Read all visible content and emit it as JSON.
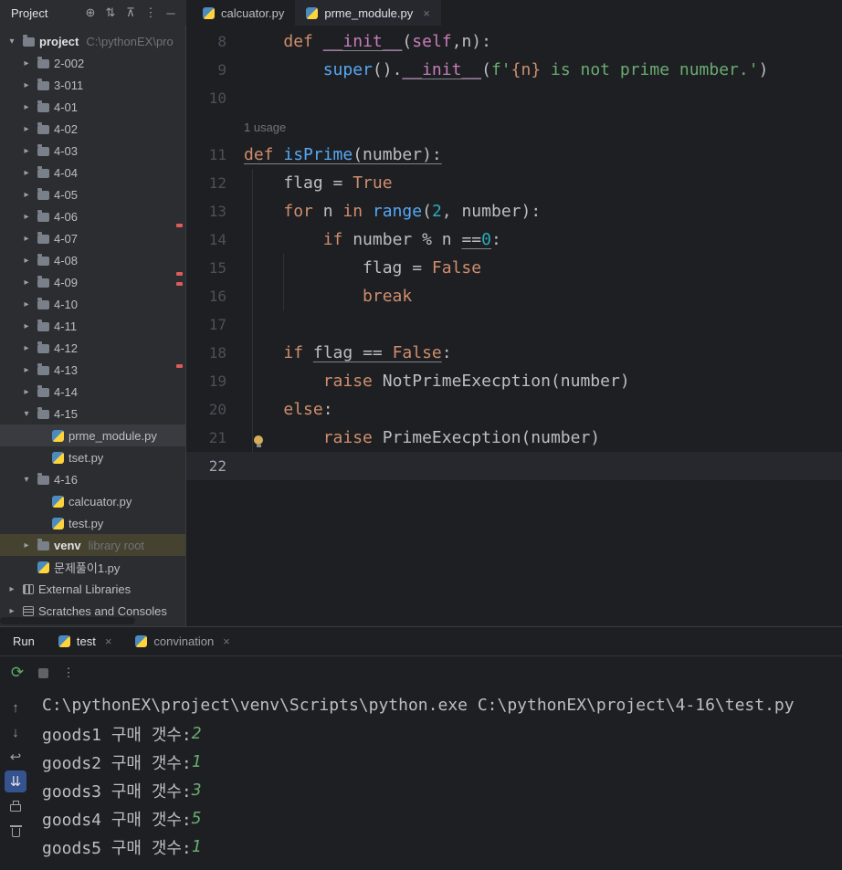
{
  "colors": {
    "bg-editor": "#1e1f22",
    "bg-panel": "#2b2d30",
    "text": "#bcbec4",
    "kw": "#cf8e6d",
    "fn": "#56a8f5",
    "magic": "#c77dbb",
    "str": "#6aab73",
    "num": "#2aacb8",
    "brace": "#cf8e6d",
    "accent": "#3574f0",
    "error": "#db5c5c",
    "console-green": "#6aab73"
  },
  "project_panel": {
    "title": "Project",
    "header_icons": [
      "select-opened-file",
      "sort",
      "collapse-all",
      "more-options",
      "hide-panel"
    ],
    "tree": [
      {
        "label": "project",
        "path_suffix": "C:\\pythonEX\\pro",
        "level": 0,
        "type": "root",
        "state": "expanded"
      },
      {
        "label": "2-002",
        "level": 1,
        "type": "folder",
        "state": "collapsed"
      },
      {
        "label": "3-011",
        "level": 1,
        "type": "folder",
        "state": "collapsed"
      },
      {
        "label": "4-01",
        "level": 1,
        "type": "folder",
        "state": "collapsed"
      },
      {
        "label": "4-02",
        "level": 1,
        "type": "folder",
        "state": "collapsed"
      },
      {
        "label": "4-03",
        "level": 1,
        "type": "folder",
        "state": "collapsed"
      },
      {
        "label": "4-04",
        "level": 1,
        "type": "folder",
        "state": "collapsed"
      },
      {
        "label": "4-05",
        "level": 1,
        "type": "folder",
        "state": "collapsed"
      },
      {
        "label": "4-06",
        "level": 1,
        "type": "folder",
        "state": "collapsed"
      },
      {
        "label": "4-07",
        "level": 1,
        "type": "folder",
        "state": "collapsed"
      },
      {
        "label": "4-08",
        "level": 1,
        "type": "folder",
        "state": "collapsed"
      },
      {
        "label": "4-09",
        "level": 1,
        "type": "folder",
        "state": "collapsed"
      },
      {
        "label": "4-10",
        "level": 1,
        "type": "folder",
        "state": "collapsed"
      },
      {
        "label": "4-11",
        "level": 1,
        "type": "folder",
        "state": "collapsed"
      },
      {
        "label": "4-12",
        "level": 1,
        "type": "folder",
        "state": "collapsed"
      },
      {
        "label": "4-13",
        "level": 1,
        "type": "folder",
        "state": "collapsed"
      },
      {
        "label": "4-14",
        "level": 1,
        "type": "folder",
        "state": "collapsed"
      },
      {
        "label": "4-15",
        "level": 1,
        "type": "folder",
        "state": "expanded"
      },
      {
        "label": "prme_module.py",
        "level": 2,
        "type": "python-file",
        "selected": true
      },
      {
        "label": "tset.py",
        "level": 2,
        "type": "python-file"
      },
      {
        "label": "4-16",
        "level": 1,
        "type": "folder",
        "state": "expanded"
      },
      {
        "label": "calcuator.py",
        "level": 2,
        "type": "python-file"
      },
      {
        "label": "test.py",
        "level": 2,
        "type": "python-file"
      },
      {
        "label": "venv",
        "suffix": "library root",
        "level": 1,
        "type": "folder",
        "state": "collapsed",
        "highlighted": true,
        "bold": true
      },
      {
        "label": "문제풀이1.py",
        "level": 1,
        "type": "python-file"
      },
      {
        "label": "External Libraries",
        "level": 0,
        "type": "libraries",
        "state": "collapsed"
      },
      {
        "label": "Scratches and Consoles",
        "level": 0,
        "type": "scratches",
        "state": "collapsed"
      }
    ]
  },
  "editor_tabs": [
    {
      "label": "calcuator.py",
      "active": false,
      "closable": false
    },
    {
      "label": "prme_module.py",
      "active": true,
      "closable": true
    }
  ],
  "editor": {
    "usage_hint": "1 usage",
    "rows": [
      {
        "num": "8",
        "segs": [
          {
            "t": "    "
          },
          {
            "t": "def ",
            "c": "kw"
          },
          {
            "t": "__init__",
            "c": "magic",
            "u": true
          },
          {
            "t": "("
          },
          {
            "t": "self",
            "c": "magic"
          },
          {
            "t": ",n):"
          }
        ]
      },
      {
        "num": "9",
        "segs": [
          {
            "t": "        "
          },
          {
            "t": "super",
            "c": "fn"
          },
          {
            "t": "()."
          },
          {
            "t": "__init__",
            "c": "magic",
            "u": true
          },
          {
            "t": "("
          },
          {
            "t": "f'",
            "c": "str"
          },
          {
            "t": "{n}",
            "c": "brace"
          },
          {
            "t": " is not prime number.'",
            "c": "str"
          },
          {
            "t": ")"
          }
        ]
      },
      {
        "num": "10",
        "segs": []
      },
      {
        "hint": true
      },
      {
        "num": "11",
        "segs": [
          {
            "t": "def ",
            "c": "kw",
            "u": true
          },
          {
            "t": "isPrime",
            "c": "fn",
            "u": true
          },
          {
            "t": "(number):",
            "u": true
          }
        ]
      },
      {
        "num": "12",
        "segs": [
          {
            "t": "    flag = "
          },
          {
            "t": "True",
            "c": "kw"
          }
        ]
      },
      {
        "num": "13",
        "segs": [
          {
            "t": "    "
          },
          {
            "t": "for ",
            "c": "kw"
          },
          {
            "t": "n "
          },
          {
            "t": "in ",
            "c": "kw"
          },
          {
            "t": "range",
            "c": "fn"
          },
          {
            "t": "("
          },
          {
            "t": "2",
            "c": "num"
          },
          {
            "t": ", number):"
          }
        ]
      },
      {
        "num": "14",
        "segs": [
          {
            "t": "        "
          },
          {
            "t": "if ",
            "c": "kw"
          },
          {
            "t": "number % n "
          },
          {
            "t": "==",
            "u": true
          },
          {
            "t": "0",
            "c": "num",
            "u": true
          },
          {
            "t": ":"
          }
        ]
      },
      {
        "num": "15",
        "segs": [
          {
            "t": "            flag = "
          },
          {
            "t": "False",
            "c": "kw"
          }
        ]
      },
      {
        "num": "16",
        "segs": [
          {
            "t": "            "
          },
          {
            "t": "break",
            "c": "kw"
          }
        ]
      },
      {
        "num": "17",
        "segs": []
      },
      {
        "num": "18",
        "segs": [
          {
            "t": "    "
          },
          {
            "t": "if ",
            "c": "kw"
          },
          {
            "t": "flag ",
            "u": true
          },
          {
            "t": "== ",
            "u": true
          },
          {
            "t": "False",
            "c": "kw",
            "u": true
          },
          {
            "t": ":"
          }
        ]
      },
      {
        "num": "19",
        "segs": [
          {
            "t": "        "
          },
          {
            "t": "raise ",
            "c": "kw"
          },
          {
            "t": "NotPrimeExecption(number)"
          }
        ]
      },
      {
        "num": "20",
        "segs": [
          {
            "t": "    "
          },
          {
            "t": "else",
            "c": "kw"
          },
          {
            "t": ":"
          }
        ]
      },
      {
        "num": "21",
        "segs": [
          {
            "t": "        "
          },
          {
            "t": "raise ",
            "c": "kw"
          },
          {
            "t": "PrimeExecption(number)"
          }
        ],
        "bulb": true
      },
      {
        "num": "22",
        "segs": [],
        "current": true
      }
    ]
  },
  "run_panel": {
    "label": "Run",
    "tabs": [
      {
        "label": "test",
        "active": true
      },
      {
        "label": "convination",
        "active": false
      }
    ],
    "toolbar_icons": [
      "rerun",
      "stop",
      "more-options"
    ],
    "side_icons": [
      {
        "name": "up"
      },
      {
        "name": "down"
      },
      {
        "name": "soft-wrap"
      },
      {
        "name": "scroll-to-end",
        "active": true
      },
      {
        "name": "print"
      },
      {
        "name": "clear"
      }
    ],
    "console": [
      {
        "text": "C:\\pythonEX\\project\\venv\\Scripts\\python.exe C:\\pythonEX\\project\\4-16\\test.py"
      },
      {
        "text": "goods1 구매 갯수:",
        "value": "2"
      },
      {
        "text": "goods2 구매 갯수:",
        "value": "1"
      },
      {
        "text": "goods3 구매 갯수:",
        "value": "3"
      },
      {
        "text": "goods4 구매 갯수:",
        "value": "5"
      },
      {
        "text": "goods5 구매 갯수:",
        "value": "1"
      }
    ]
  }
}
